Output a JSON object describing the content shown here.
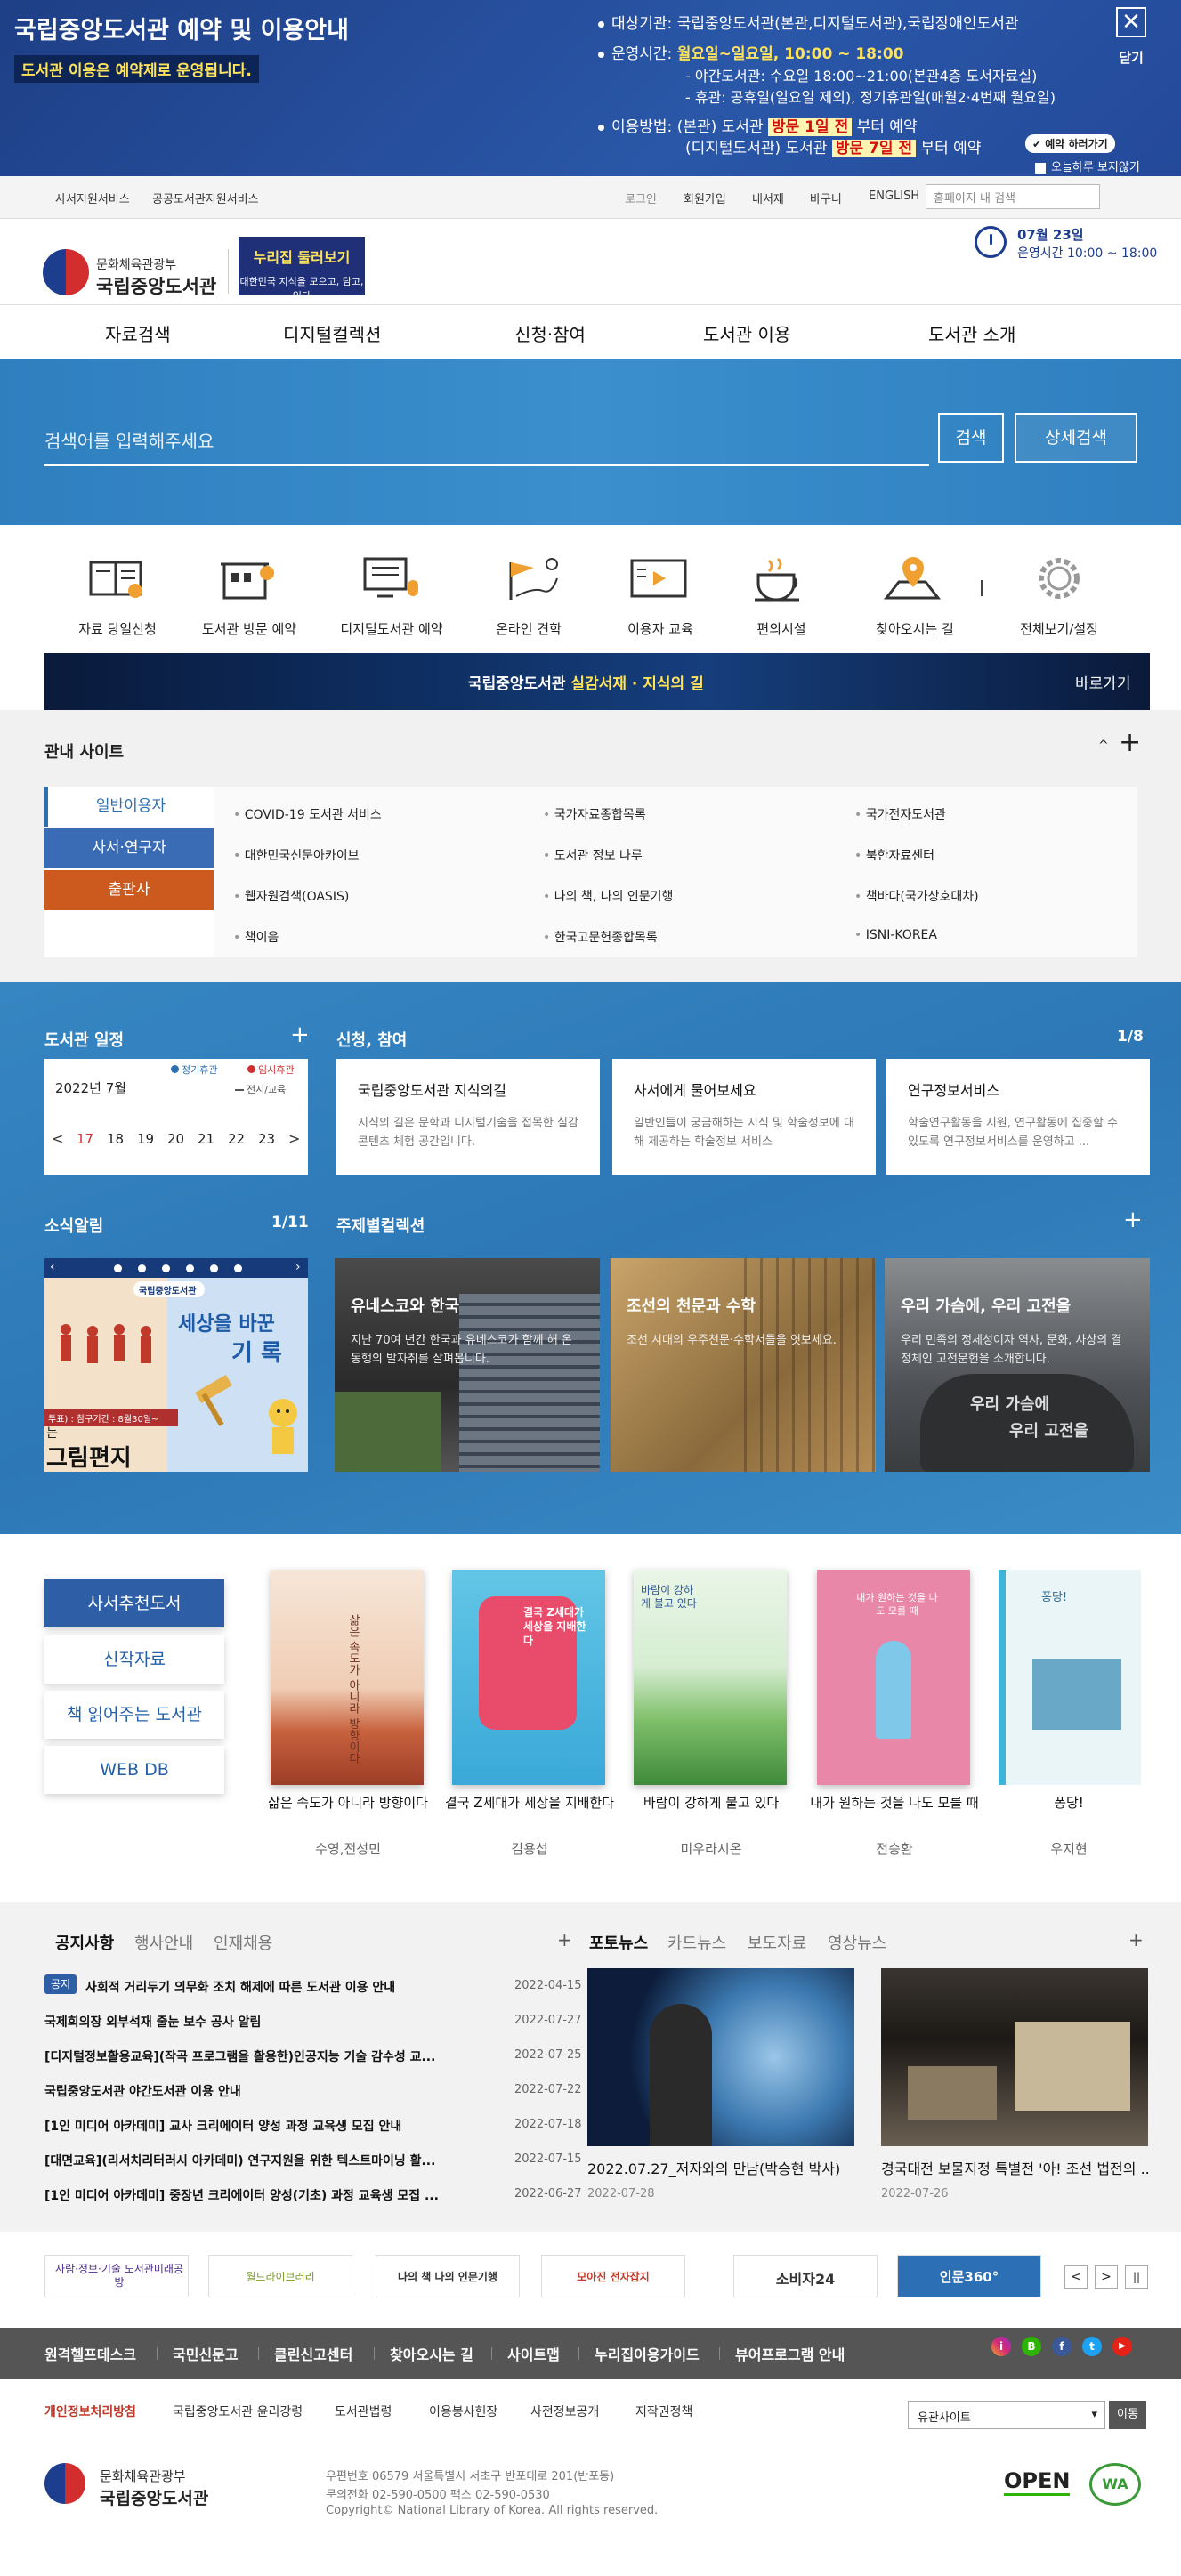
{
  "notice": {
    "title": "국립중앙도서관 예약 및 이용안내",
    "sub": "도서관 이용은 예약제로 운영됩니다.",
    "target_label": "대상기관:",
    "target_value": "국립중앙도서관(본관,디지털도서관),국립장애인도서관",
    "hours_label": "운영시간:",
    "hours_value": "월요일~일요일, 10:00 ~ 18:00",
    "night": "- 야간도서관: 수요일 18:00~21:00(본관4층 도서자료실)",
    "closed": "- 휴관: 공휴일(일요일 제외), 정기휴관일(매월2·4번째 월요일)",
    "method_label": "이용방법:",
    "m1a": "(본관) 도서관",
    "m1b": "방문 1일 전",
    "m1c": "부터 예약",
    "m2a": "(디지털도서관) 도서관",
    "m2b": "방문 7일 전",
    "m2c": "부터 예약",
    "reserve_btn": "예약 하러가기",
    "today_close": "오늘하루 보지않기",
    "close_label": "닫기",
    "close_icon": "✕"
  },
  "util": {
    "left": [
      "사서지원서비스",
      "공공도서관지원서비스"
    ],
    "right": [
      "로그인",
      "회원가입",
      "내서재",
      "바구니",
      "ENGLISH"
    ],
    "search_placeholder": "홈페이지 내 검색"
  },
  "header": {
    "ministry": "문화체육관광부",
    "library": "국립중앙도서관",
    "promo_title": "누리집 둘러보기",
    "promo_sub": "대한민국 지식을 모으고, 담고, 잇다",
    "date": "07월 23일",
    "hours": "운영시간 10:00 ~ 18:00"
  },
  "gnb": [
    "자료검색",
    "디지털컬렉션",
    "신청·참여",
    "도서관 이용",
    "도서관 소개"
  ],
  "search": {
    "placeholder": "검색어를 입력해주세요",
    "button": "검색",
    "detail": "상세검색"
  },
  "quick": [
    "자료 당일신청",
    "도서관 방문 예약",
    "디지털도서관 예약",
    "온라인 견학",
    "이용자 교육",
    "편의시설",
    "찾아오시는 길",
    "전체보기/설정"
  ],
  "banner": {
    "text_a": "국립중앙도서관",
    "text_b": "실감서재 · 지식의 길",
    "go": "바로가기"
  },
  "related": {
    "title": "관내 사이트",
    "caret": "^",
    "plus": "+",
    "tabs": [
      "일반이용자",
      "사서·연구자",
      "출판사"
    ],
    "col1": [
      "COVID-19 도서관 서비스",
      "대한민국신문아카이브",
      "웹자원검색(OASIS)",
      "책이음"
    ],
    "col2": [
      "국가자료종합목록",
      "도서관 정보 나루",
      "나의 책, 나의 인문기행",
      "한국고문헌종합목록"
    ],
    "col3": [
      "국가전자도서관",
      "북한자료센터",
      "책바다(국가상호대차)",
      "ISNI-KOREA"
    ]
  },
  "schedule": {
    "title": "도서관 일정",
    "plus": "+",
    "legend": [
      "정기휴관",
      "임시휴관",
      "전시/교육"
    ],
    "month": "2022년 7월",
    "days": [
      "17",
      "18",
      "19",
      "20",
      "21",
      "22",
      "23"
    ],
    "prev": "<",
    "next": ">"
  },
  "apply": {
    "title": "신청, 참여",
    "page": "1/8",
    "cards": [
      {
        "t": "국립중앙도서관 지식의길",
        "d": "지식의 길은 문학과 디지털기술을 접목한 실감 콘텐츠 체험 공간입니다."
      },
      {
        "t": "사서에게 물어보세요",
        "d": "일반인들이 궁금해하는 지식 및 학술정보에 대해 제공하는 학술정보 서비스"
      },
      {
        "t": "연구정보서비스",
        "d": "학술연구활동을 지원, 연구활동에 집중할 수 있도록 연구정보서비스를 운영하고 ..."
      }
    ]
  },
  "news": {
    "title": "소식알림",
    "page": "1/11",
    "image_text_a": "세상을 바꾼",
    "image_text_b": "기 록",
    "image_text_c": "그림편지",
    "image_text_d": "는",
    "image_text_e": "투표) : 참구기간 : 8월30일~",
    "image_logo": "국립중앙도서관"
  },
  "collection": {
    "title": "주제별컬렉션",
    "plus": "+",
    "items": [
      {
        "t": "유네스코와 한국",
        "d": "지난 70여 년간 한국과 유네스코가 함께 해 온 동행의 발자취를 살펴봅니다."
      },
      {
        "t": "조선의 천문과 수학",
        "d": "조선 시대의 우주천문·수학서들을 엿보세요."
      },
      {
        "t": "우리 가슴에, 우리 고전을",
        "d": "우리 민족의 정체성이자 역사, 문화, 사상의 결정체인 고전문헌을 소개합니다."
      }
    ],
    "stone_text_a": "우리 가슴에",
    "stone_text_b": "우리 고전을"
  },
  "recommend": {
    "tabs": [
      "사서추천도서",
      "신작자료",
      "책 읽어주는 도서관",
      "WEB DB"
    ],
    "books": [
      {
        "title": "삶은 속도가 아니라 방향이다",
        "author": "수영,전성민",
        "cover": "삶은 속도가 아니라 방향이다"
      },
      {
        "title": "결국 Z세대가 세상을 지배한다",
        "author": "김용섭",
        "cover": "결국 Z세대가 세상을 지배한다"
      },
      {
        "title": "바람이 강하게 불고 있다",
        "author": "미우라시온",
        "cover": "바람이 강하게 불고 있다"
      },
      {
        "title": "내가 원하는 것을 나도 모를 때",
        "author": "전승환",
        "cover": "내가 원하는 것을 나도 모를 때"
      },
      {
        "title": "퐁당!",
        "author": "우지현",
        "cover": "퐁당!"
      }
    ]
  },
  "notices": {
    "tabs": [
      "공지사항",
      "행사안내",
      "인재채용"
    ],
    "plus": "+",
    "badge": "공지",
    "rows": [
      {
        "t": "사회적 거리두기 의무화 조치 해제에 따른 도서관 이용 안내",
        "d": "2022-04-15"
      },
      {
        "t": "국제회의장 외부석재 줄눈 보수 공사 알림",
        "d": "2022-07-27"
      },
      {
        "t": "[디지털정보활용교육](작곡 프로그램을 활용한)인공지능 기술 감수성 교...",
        "d": "2022-07-25"
      },
      {
        "t": "국립중앙도서관 야간도서관 이용 안내",
        "d": "2022-07-22"
      },
      {
        "t": "[1인 미디어 아카데미] 교사 크리에이터 양성 과정 교육생 모집 안내",
        "d": "2022-07-18"
      },
      {
        "t": "[대면교육](리서치리터러시 아카데미) 연구지원을 위한 텍스트마이닝 활...",
        "d": "2022-07-15"
      },
      {
        "t": "[1인 미디어 아카데미] 중장년 크리에이터 양성(기초) 과정 교육생 모집 ...",
        "d": "2022-06-27"
      }
    ]
  },
  "photonews": {
    "tabs": [
      "포토뉴스",
      "카드뉴스",
      "보도자료",
      "영상뉴스"
    ],
    "plus": "+",
    "items": [
      {
        "c": "2022.07.27_저자와의 만남(박승현 박사)",
        "d": "2022-07-28"
      },
      {
        "c": "경국대전 보물지정 특별전 '아! 조선 법전의 ...",
        "d": "2022-07-26"
      }
    ]
  },
  "partners": [
    "사람·정보·기술 도서관미래공방",
    "월드라이브러리",
    "나의 책 나의 인문기행",
    "모아진 전자잡지",
    "소비자24",
    "인문360°"
  ],
  "partner_nav": [
    "<",
    ">",
    "||"
  ],
  "footer": {
    "nav": [
      "원격헬프데스크",
      "국민신문고",
      "클린신고센터",
      "찾아오시는 길",
      "사이트맵",
      "누리집이용가이드",
      "뷰어프로그램 안내"
    ],
    "sns": [
      "i",
      "B",
      "f",
      "t",
      "▶"
    ],
    "links": [
      "개인정보처리방침",
      "국립중앙도서관 윤리강령",
      "도서관법령",
      "이용봉사헌장",
      "사전정보공개",
      "저작권정책"
    ],
    "select": "유관사이트",
    "go": "이동",
    "ministry": "문화체육관광부",
    "library": "국립중앙도서관",
    "addr": "우편번호 06579 서울특별시 서초구 반포대로 201(반포동)",
    "tel": "문의전화 02-590-0500 팩스 02-590-0530",
    "copy": "Copyright© National Library of Korea. All rights reserved.",
    "open": "OPEN",
    "wa": "WA"
  },
  "colors": {
    "primary": "#1d3d8f",
    "accent": "#2f7fbf",
    "highlight": "#ffe45b",
    "red": "#d41111"
  }
}
